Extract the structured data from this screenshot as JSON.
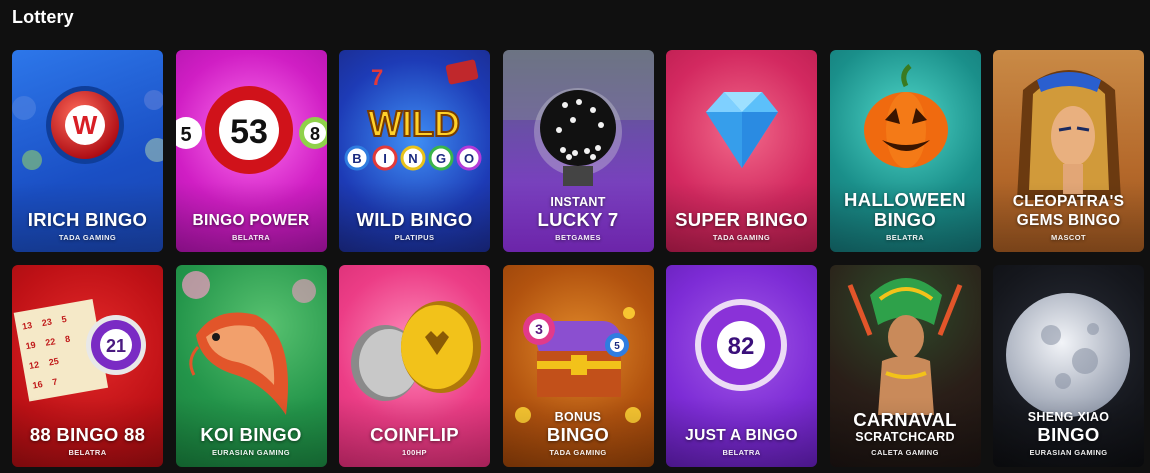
{
  "section": {
    "title": "Lottery"
  },
  "games": [
    {
      "title": "IRICH BINGO",
      "provider": "TADA GAMING",
      "color": "#1f5ed6"
    },
    {
      "title": "BINGO POWER",
      "provider": "BELATRA",
      "color": "#d21fc4"
    },
    {
      "title": "WILD BINGO",
      "provider": "PLATIPUS",
      "color": "#2233b0"
    },
    {
      "pre": "INSTANT",
      "title": "LUCKY 7",
      "provider": "BETGAMES",
      "color": "#8a2fd8"
    },
    {
      "title": "SUPER BINGO",
      "provider": "TADA GAMING",
      "color": "#d0275c"
    },
    {
      "title": "HALLOWEEN",
      "title2": "BINGO",
      "provider": "BELATRA",
      "color": "#1d8a86"
    },
    {
      "title": "CLEOPATRA'S",
      "title2": "GEMS BINGO",
      "provider": "MASCOT",
      "color": "#b4682a"
    },
    {
      "title": "88 BINGO 88",
      "provider": "BELATRA",
      "color": "#c4141a"
    },
    {
      "title": "KOI BINGO",
      "provider": "EURASIAN GAMING",
      "color": "#1f9448"
    },
    {
      "title": "COINFLIP",
      "provider": "100HP",
      "color": "#ec3d86"
    },
    {
      "pre": "BONUS",
      "title": "BINGO",
      "provider": "TADA GAMING",
      "color": "#b2530f"
    },
    {
      "title": "JUST A BINGO",
      "provider": "BELATRA",
      "color": "#7d2cd6"
    },
    {
      "title": "CARNAVAL",
      "title2": "SCRATCHCARD",
      "provider": "CALETA GAMING",
      "color": "#3e2a22"
    },
    {
      "title": "SHENG XIAO",
      "title2": "BINGO",
      "provider": "EURASIAN GAMING",
      "color": "#14161c"
    }
  ],
  "art": {
    "ball_letter": "W",
    "ball_53": "53",
    "ball_5": "5",
    "ball_8": "8",
    "wild_logo": "WILD",
    "wild_balls": [
      "B",
      "I",
      "N",
      "G",
      "O"
    ],
    "ball_21": "21",
    "ball_3": "3",
    "chest_ball": "5",
    "ball_82": "82",
    "bingo_card_nums": [
      "13",
      "23",
      "5",
      "19",
      "22",
      "8",
      "12",
      "25",
      "16",
      "7"
    ]
  }
}
